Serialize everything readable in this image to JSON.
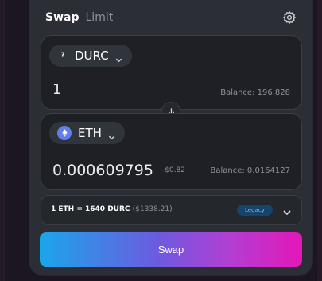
{
  "tabs": {
    "swap": "Swap",
    "limit": "Limit"
  },
  "from": {
    "token": "DURC",
    "token_icon": "?",
    "amount": "1",
    "balance": "Balance: 196.828"
  },
  "to": {
    "token": "ETH",
    "amount": "0.000609795",
    "usd": "-$0.82",
    "balance": "Balance: 0.0164127"
  },
  "rate": {
    "text": "1 ETH = 1640 DURC",
    "usd": "($1338.21)",
    "badge": "Legacy"
  },
  "swap_button": "Swap",
  "colors": {
    "accent_start": "#1aa6ea",
    "accent_end": "#e417b8",
    "eth_icon": "#627eea"
  }
}
